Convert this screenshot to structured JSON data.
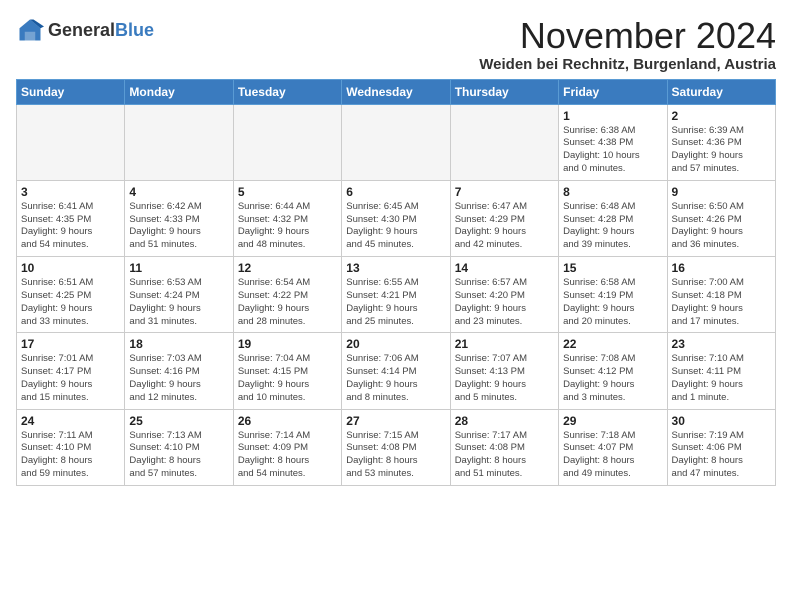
{
  "logo": {
    "general": "General",
    "blue": "Blue"
  },
  "title": "November 2024",
  "location": "Weiden bei Rechnitz, Burgenland, Austria",
  "headers": [
    "Sunday",
    "Monday",
    "Tuesday",
    "Wednesday",
    "Thursday",
    "Friday",
    "Saturday"
  ],
  "weeks": [
    [
      {
        "day": "",
        "info": ""
      },
      {
        "day": "",
        "info": ""
      },
      {
        "day": "",
        "info": ""
      },
      {
        "day": "",
        "info": ""
      },
      {
        "day": "",
        "info": ""
      },
      {
        "day": "1",
        "info": "Sunrise: 6:38 AM\nSunset: 4:38 PM\nDaylight: 10 hours\nand 0 minutes."
      },
      {
        "day": "2",
        "info": "Sunrise: 6:39 AM\nSunset: 4:36 PM\nDaylight: 9 hours\nand 57 minutes."
      }
    ],
    [
      {
        "day": "3",
        "info": "Sunrise: 6:41 AM\nSunset: 4:35 PM\nDaylight: 9 hours\nand 54 minutes."
      },
      {
        "day": "4",
        "info": "Sunrise: 6:42 AM\nSunset: 4:33 PM\nDaylight: 9 hours\nand 51 minutes."
      },
      {
        "day": "5",
        "info": "Sunrise: 6:44 AM\nSunset: 4:32 PM\nDaylight: 9 hours\nand 48 minutes."
      },
      {
        "day": "6",
        "info": "Sunrise: 6:45 AM\nSunset: 4:30 PM\nDaylight: 9 hours\nand 45 minutes."
      },
      {
        "day": "7",
        "info": "Sunrise: 6:47 AM\nSunset: 4:29 PM\nDaylight: 9 hours\nand 42 minutes."
      },
      {
        "day": "8",
        "info": "Sunrise: 6:48 AM\nSunset: 4:28 PM\nDaylight: 9 hours\nand 39 minutes."
      },
      {
        "day": "9",
        "info": "Sunrise: 6:50 AM\nSunset: 4:26 PM\nDaylight: 9 hours\nand 36 minutes."
      }
    ],
    [
      {
        "day": "10",
        "info": "Sunrise: 6:51 AM\nSunset: 4:25 PM\nDaylight: 9 hours\nand 33 minutes."
      },
      {
        "day": "11",
        "info": "Sunrise: 6:53 AM\nSunset: 4:24 PM\nDaylight: 9 hours\nand 31 minutes."
      },
      {
        "day": "12",
        "info": "Sunrise: 6:54 AM\nSunset: 4:22 PM\nDaylight: 9 hours\nand 28 minutes."
      },
      {
        "day": "13",
        "info": "Sunrise: 6:55 AM\nSunset: 4:21 PM\nDaylight: 9 hours\nand 25 minutes."
      },
      {
        "day": "14",
        "info": "Sunrise: 6:57 AM\nSunset: 4:20 PM\nDaylight: 9 hours\nand 23 minutes."
      },
      {
        "day": "15",
        "info": "Sunrise: 6:58 AM\nSunset: 4:19 PM\nDaylight: 9 hours\nand 20 minutes."
      },
      {
        "day": "16",
        "info": "Sunrise: 7:00 AM\nSunset: 4:18 PM\nDaylight: 9 hours\nand 17 minutes."
      }
    ],
    [
      {
        "day": "17",
        "info": "Sunrise: 7:01 AM\nSunset: 4:17 PM\nDaylight: 9 hours\nand 15 minutes."
      },
      {
        "day": "18",
        "info": "Sunrise: 7:03 AM\nSunset: 4:16 PM\nDaylight: 9 hours\nand 12 minutes."
      },
      {
        "day": "19",
        "info": "Sunrise: 7:04 AM\nSunset: 4:15 PM\nDaylight: 9 hours\nand 10 minutes."
      },
      {
        "day": "20",
        "info": "Sunrise: 7:06 AM\nSunset: 4:14 PM\nDaylight: 9 hours\nand 8 minutes."
      },
      {
        "day": "21",
        "info": "Sunrise: 7:07 AM\nSunset: 4:13 PM\nDaylight: 9 hours\nand 5 minutes."
      },
      {
        "day": "22",
        "info": "Sunrise: 7:08 AM\nSunset: 4:12 PM\nDaylight: 9 hours\nand 3 minutes."
      },
      {
        "day": "23",
        "info": "Sunrise: 7:10 AM\nSunset: 4:11 PM\nDaylight: 9 hours\nand 1 minute."
      }
    ],
    [
      {
        "day": "24",
        "info": "Sunrise: 7:11 AM\nSunset: 4:10 PM\nDaylight: 8 hours\nand 59 minutes."
      },
      {
        "day": "25",
        "info": "Sunrise: 7:13 AM\nSunset: 4:10 PM\nDaylight: 8 hours\nand 57 minutes."
      },
      {
        "day": "26",
        "info": "Sunrise: 7:14 AM\nSunset: 4:09 PM\nDaylight: 8 hours\nand 54 minutes."
      },
      {
        "day": "27",
        "info": "Sunrise: 7:15 AM\nSunset: 4:08 PM\nDaylight: 8 hours\nand 53 minutes."
      },
      {
        "day": "28",
        "info": "Sunrise: 7:17 AM\nSunset: 4:08 PM\nDaylight: 8 hours\nand 51 minutes."
      },
      {
        "day": "29",
        "info": "Sunrise: 7:18 AM\nSunset: 4:07 PM\nDaylight: 8 hours\nand 49 minutes."
      },
      {
        "day": "30",
        "info": "Sunrise: 7:19 AM\nSunset: 4:06 PM\nDaylight: 8 hours\nand 47 minutes."
      }
    ]
  ]
}
